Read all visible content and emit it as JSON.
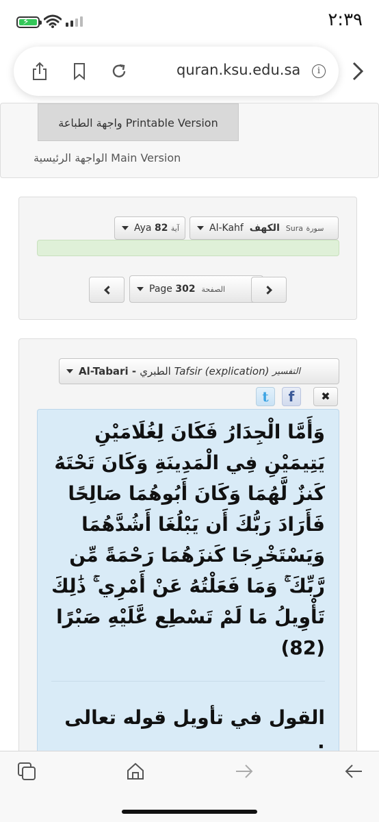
{
  "status_bar": {
    "time": "٢:٣٩",
    "icons": [
      "battery-charging-icon",
      "wifi-icon",
      "cellular-signal-icon",
      "location-arrow-icon"
    ]
  },
  "browser": {
    "url": "quran.ksu.edu.sa",
    "icons": [
      "share-icon",
      "bookmark-icon",
      "reload-icon",
      "info-icon",
      "forward-chevron-icon"
    ]
  },
  "versions": {
    "printable_label": "واجهة الطباعة Printable Version",
    "main_label": "الواجهة الرئيسية Main Version"
  },
  "navigation": {
    "sura": {
      "prefix_ar": "سورة",
      "prefix_en": "Sura",
      "name_ar": "الكهف",
      "name_en": "Al-Kahf"
    },
    "aya": {
      "prefix_ar": "آية",
      "number": "82",
      "prefix_en": "Aya"
    },
    "page": {
      "prefix_ar": "الصفحة",
      "number": "302",
      "prefix_en": "Page"
    }
  },
  "tafsir": {
    "label_ar": "التفسير",
    "label_en": "Tafsir (explication)",
    "book_ar": "الطبري",
    "book_en": "Al-Tabari",
    "verse_text": "وَأَمَّا الْجِدَارُ فَكَانَ لِغُلَامَيْنِ يَتِيمَيْنِ فِي الْمَدِينَةِ وَكَانَ تَحْتَهُ كَنزٌ لَّهُمَا وَكَانَ أَبُوهُمَا صَالِحًا فَأَرَادَ رَبُّكَ أَن يَبْلُغَا أَشُدَّهُمَا وَيَسْتَخْرِجَا كَنزَهُمَا رَحْمَةً مِّن رَّبِّكَ ۚ وَمَا فَعَلْتُهُ عَنْ أَمْرِي ۚ ذَٰلِكَ تَأْوِيلُ مَا لَمْ تَسْطِع عَّلَيْهِ صَبْرًا (82)",
    "commentary_heading": "القول في تأويل قوله تعالى :"
  },
  "bottom_toolbar": {
    "icons": [
      "tabs-icon",
      "home-icon",
      "forward-arrow-icon",
      "back-arrow-icon"
    ]
  }
}
